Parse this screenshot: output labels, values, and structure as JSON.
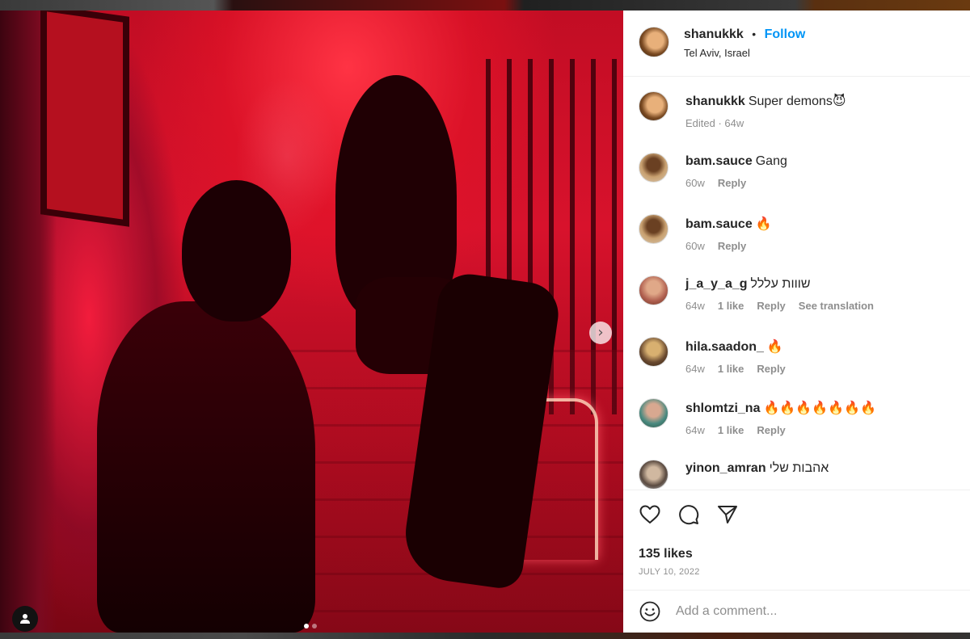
{
  "post": {
    "username": "shanukkk",
    "separator": "•",
    "follow_label": "Follow",
    "location": "Tel Aviv, Israel",
    "next_label": "›",
    "dots": 2,
    "active_dot": 0
  },
  "comments": [
    {
      "user": "shanukkk",
      "text": "Super demons😈",
      "meta": [
        "Edited · 64w"
      ],
      "actions": []
    },
    {
      "user": "bam.sauce",
      "text": "Gang",
      "meta": [
        "60w"
      ],
      "actions": [
        "Reply"
      ]
    },
    {
      "user": "bam.sauce",
      "text": "🔥",
      "meta": [
        "60w"
      ],
      "actions": [
        "Reply"
      ]
    },
    {
      "user": "j_a_y_a_g",
      "text": "שווות עללל",
      "meta": [
        "64w"
      ],
      "actions": [
        "1 like",
        "Reply",
        "See translation"
      ]
    },
    {
      "user": "hila.saadon_",
      "text": "🔥",
      "meta": [
        "64w"
      ],
      "actions": [
        "1 like",
        "Reply"
      ]
    },
    {
      "user": "shlomtzi_na",
      "text": "🔥🔥🔥🔥🔥🔥🔥",
      "meta": [
        "64w"
      ],
      "actions": [
        "1 like",
        "Reply"
      ]
    },
    {
      "user": "yinon_amran",
      "text": "אהבות שלי",
      "meta": [],
      "actions": []
    }
  ],
  "footer": {
    "likes": "135 likes",
    "date": "JULY 10, 2022",
    "comment_placeholder": "Add a comment..."
  },
  "icons": [
    "heart-icon",
    "comment-icon",
    "share-icon",
    "emoji-icon",
    "user-tag-icon",
    "chevron-right-icon"
  ],
  "colors": {
    "accent": "#0095f6",
    "muted": "#8e8e8e",
    "text": "#262626"
  }
}
